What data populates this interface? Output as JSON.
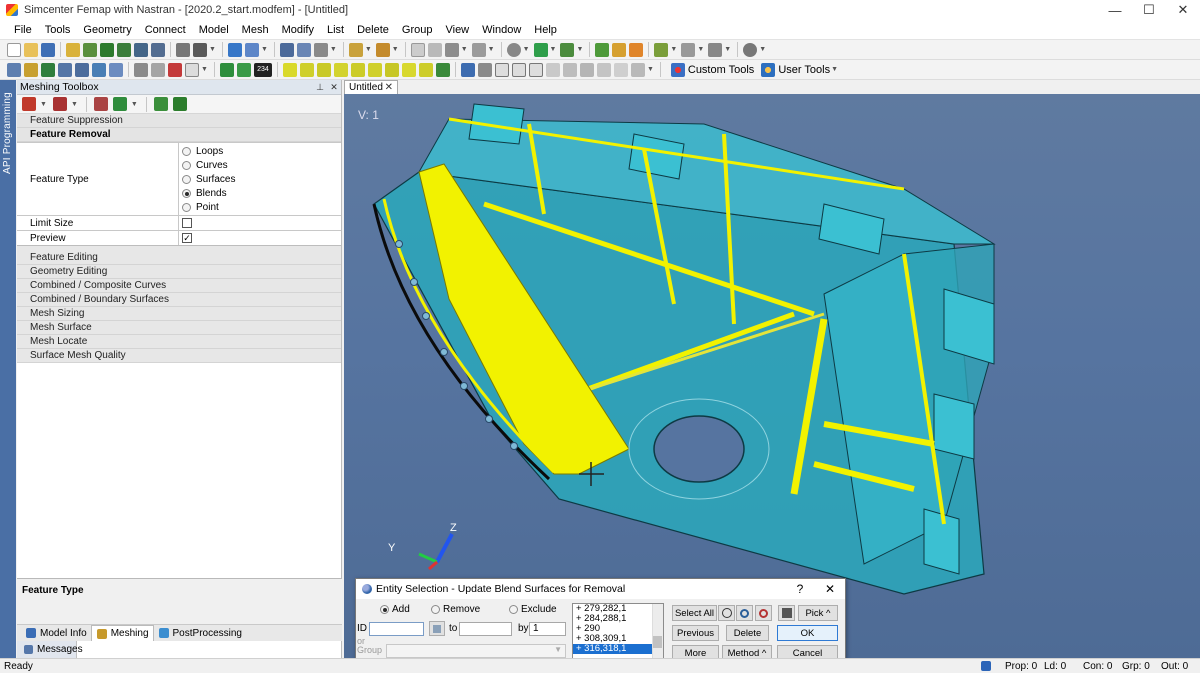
{
  "window": {
    "title": "Simcenter Femap with Nastran - [2020.2_start.modfem] - [Untitled]",
    "minimize": "—",
    "maximize": "☐",
    "close": "✕"
  },
  "menu": [
    "File",
    "Tools",
    "Geometry",
    "Connect",
    "Model",
    "Mesh",
    "Modify",
    "List",
    "Delete",
    "Group",
    "View",
    "Window",
    "Help"
  ],
  "toolbar": {
    "custom_tools": "Custom Tools",
    "user_tools": "User Tools",
    "count_badge": "234"
  },
  "side_strip": {
    "label": "API Programming"
  },
  "panel": {
    "title": "Meshing Toolbox",
    "pin": "⊥",
    "close": "✕",
    "section_suppression": "Feature Suppression",
    "section_removal": "Feature Removal",
    "feature_type_label": "Feature Type",
    "feature_types": [
      {
        "label": "Loops",
        "selected": false
      },
      {
        "label": "Curves",
        "selected": false
      },
      {
        "label": "Surfaces",
        "selected": false
      },
      {
        "label": "Blends",
        "selected": true
      },
      {
        "label": "Point",
        "selected": false
      }
    ],
    "limit_size_label": "Limit Size",
    "preview_label": "Preview",
    "preview_check": "✓",
    "sections": [
      "Feature Editing",
      "Geometry Editing",
      "Combined / Composite Curves",
      "Combined / Boundary Surfaces",
      "Mesh Sizing",
      "Mesh Surface",
      "Mesh Locate",
      "Surface Mesh Quality"
    ],
    "help_title": "Feature Type"
  },
  "bottom_tabs": [
    "Model Info",
    "Meshing",
    "PostProcessing"
  ],
  "messages_tab": "Messages",
  "view": {
    "tab": "Untitled",
    "tab_close": "✕",
    "label": "V: 1",
    "axis_x": "X",
    "axis_y": "Y",
    "axis_z": "Z"
  },
  "dialog": {
    "title": "Entity Selection - Update Blend Surfaces for Removal",
    "help": "?",
    "close": "✕",
    "mode_add": "Add",
    "mode_remove": "Remove",
    "mode_exclude": "Exclude",
    "id_label": "ID",
    "to_label": "to",
    "by_label": "by",
    "by_value": "1",
    "or_label": "or",
    "group_label": "Group",
    "list": [
      "+  279,282,1",
      "+  284,288,1",
      "+  290",
      "+  308,309,1",
      "+  316,318,1"
    ],
    "select_all": "Select All",
    "pick": "Pick ^",
    "previous": "Previous",
    "delete": "Delete",
    "ok": "OK",
    "more": "More",
    "method": "Method ^",
    "cancel": "Cancel"
  },
  "status": {
    "ready": "Ready",
    "items": [
      "Prop: 0",
      "Ld: 0",
      "Con: 0",
      "Grp: 0",
      "Out: 0"
    ]
  },
  "colors": {
    "viewport_bg": "#5674a0",
    "part_fill": "#29b3c6",
    "highlight": "#f2f200",
    "accent": "#1b6fd0"
  }
}
